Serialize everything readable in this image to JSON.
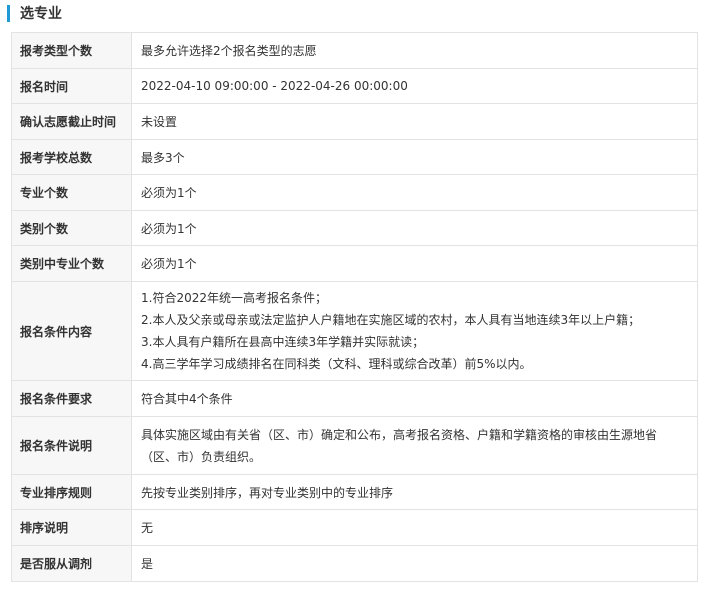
{
  "section": {
    "title": "选专业"
  },
  "rows": [
    {
      "label": "报考类型个数",
      "value": "最多允许选择2个报名类型的志愿"
    },
    {
      "label": "报名时间",
      "value": "2022-04-10 09:00:00 - 2022-04-26 00:00:00"
    },
    {
      "label": "确认志愿截止时间",
      "value": "未设置"
    },
    {
      "label": "报考学校总数",
      "value": "最多3个"
    },
    {
      "label": "专业个数",
      "value": "必须为1个"
    },
    {
      "label": "类别个数",
      "value": "必须为1个"
    },
    {
      "label": "类别中专业个数",
      "value": "必须为1个"
    },
    {
      "label": "报名条件内容",
      "lines": [
        "1.符合2022年统一高考报名条件；",
        "2.本人及父亲或母亲或法定监护人户籍地在实施区域的农村，本人具有当地连续3年以上户籍；",
        "3.本人具有户籍所在县高中连续3年学籍并实际就读；",
        "4.高三学年学习成绩排名在同科类（文科、理科或综合改革）前5%以内。"
      ]
    },
    {
      "label": "报名条件要求",
      "value": "符合其中4个条件"
    },
    {
      "label": "报名条件说明",
      "lines": [
        "具体实施区域由有关省（区、市）确定和公布，高考报名资格、户籍和学籍资格的审核由生源地省",
        "（区、市）负责组织。"
      ]
    },
    {
      "label": "专业排序规则",
      "value": "先按专业类别排序，再对专业类别中的专业排序"
    },
    {
      "label": "排序说明",
      "value": "无"
    },
    {
      "label": "是否服从调剂",
      "value": "是"
    }
  ]
}
